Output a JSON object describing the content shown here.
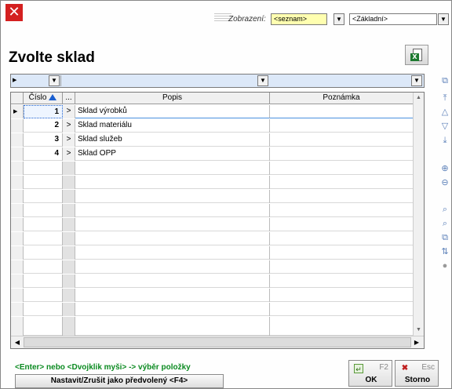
{
  "window": {
    "title": "Zvolte sklad",
    "close_glyph": "✕"
  },
  "toolbar": {
    "display_label": "Zobrazení:",
    "display_value": "<seznam>",
    "view_value": "<Základní>"
  },
  "grid": {
    "columns": [
      "Číslo",
      "...",
      "Popis",
      "Poznámka"
    ],
    "rows": [
      {
        "cislo": "1",
        "popis": "Sklad výrobků",
        "poznamka": ""
      },
      {
        "cislo": "2",
        "popis": "Sklad materiálu",
        "poznamka": ""
      },
      {
        "cislo": "3",
        "popis": "Sklad služeb",
        "poznamka": ""
      },
      {
        "cislo": "4",
        "popis": "Sklad OPP",
        "poznamka": ""
      }
    ],
    "row_button_glyph": ">"
  },
  "footer": {
    "hint": "<Enter> nebo <Dvojklik myši> -> výběr položky",
    "default_button": "Nastavit/Zrušit jako předvolený <F4>",
    "ok_key": "F2",
    "ok_label": "OK",
    "cancel_key": "Esc",
    "cancel_label": "Storno"
  },
  "icons": {
    "excel": "excel-export-icon",
    "sort": "sort-ascending-icon"
  },
  "colors": {
    "close": "#d42020",
    "hint": "#0a8a20",
    "filter_row": "#dce8f8",
    "combo_highlight": "#ffffb0"
  }
}
